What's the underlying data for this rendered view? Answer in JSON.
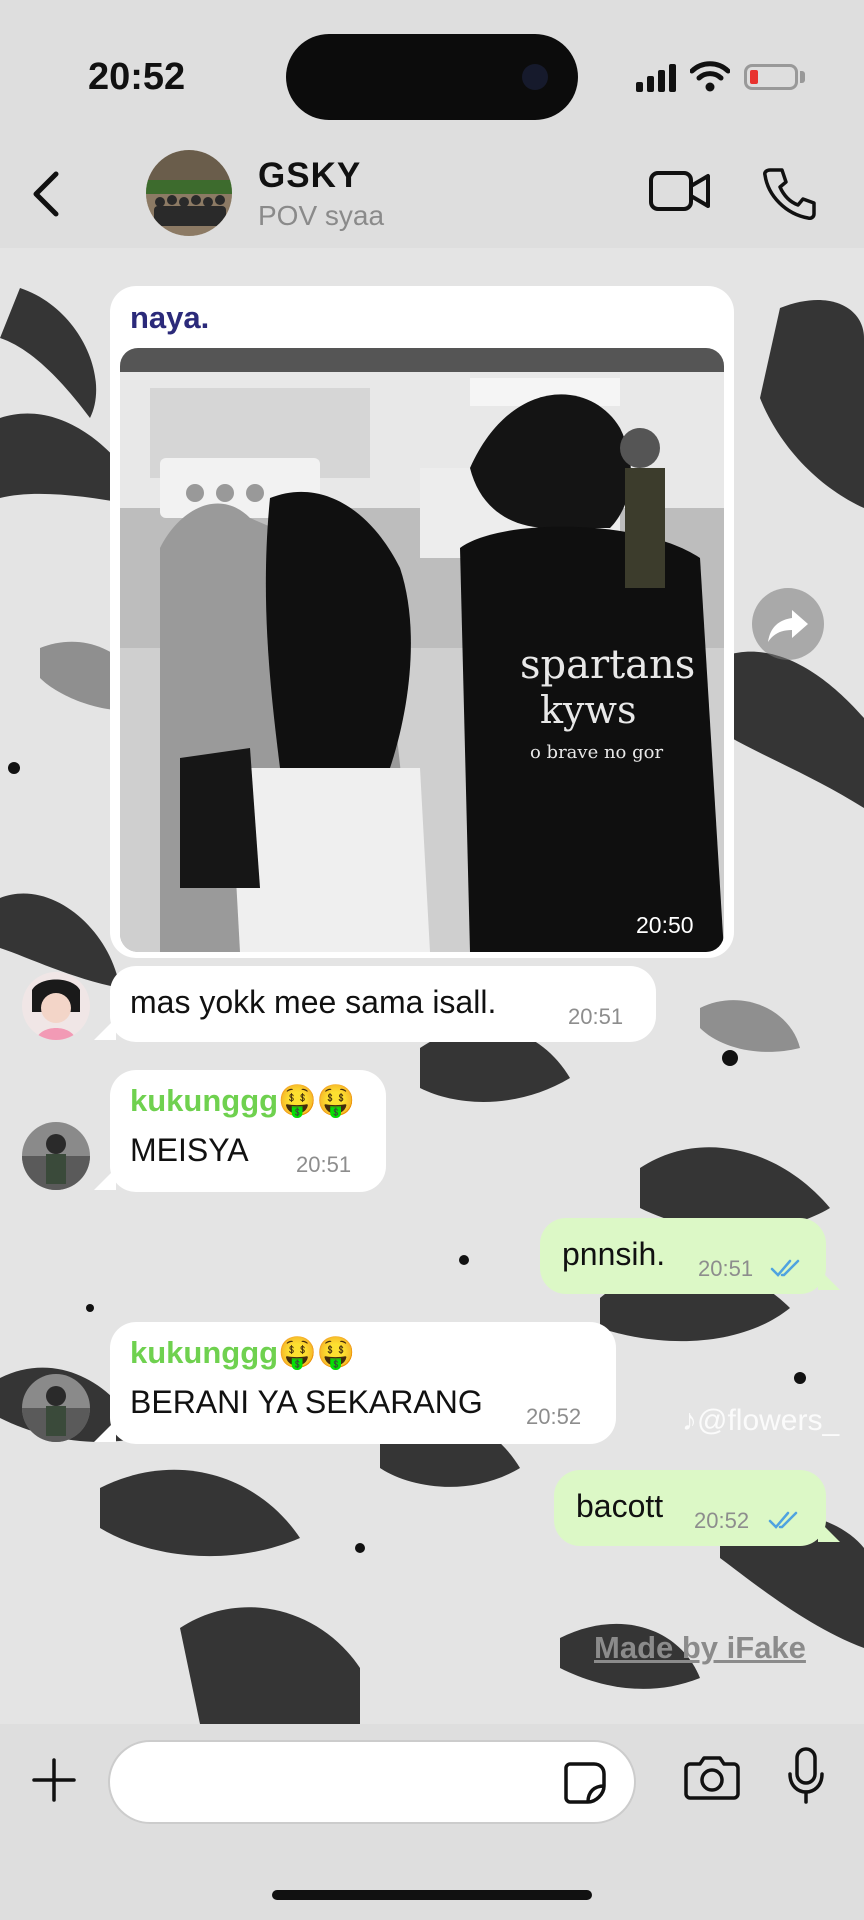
{
  "status_bar": {
    "time": "20:52"
  },
  "header": {
    "title": "GSKY",
    "subtitle": "POV syaa",
    "icons": [
      "back-chevron-icon",
      "video-camera-icon",
      "phone-icon"
    ]
  },
  "messages": [
    {
      "type": "image",
      "sender": "naya.",
      "sender_color": "#2b2a7a",
      "time": "20:50"
    },
    {
      "type": "text",
      "text": "mas yokk mee sama isall.",
      "time": "20:51",
      "direction": "incoming"
    },
    {
      "type": "text",
      "sender": "kukunggg🤑🤑",
      "sender_color": "#6fd14f",
      "text": "MEISYA",
      "time": "20:51",
      "direction": "incoming"
    },
    {
      "type": "text",
      "text": "pnnsih.",
      "time": "20:51",
      "direction": "outgoing",
      "read": true
    },
    {
      "type": "text",
      "sender": "kukunggg🤑🤑",
      "sender_color": "#6fd14f",
      "text": "BERANI YA SEKARANG",
      "time": "20:52",
      "direction": "incoming"
    },
    {
      "type": "text",
      "text": "bacott",
      "time": "20:52",
      "direction": "outgoing",
      "read": true
    }
  ],
  "overlay": {
    "tiktok_watermark": "♪@flowers_",
    "made_by": "Made by iFake"
  },
  "input_bar": {
    "placeholder": "",
    "icons": [
      "plus-icon",
      "sticker-icon",
      "camera-icon",
      "microphone-icon"
    ]
  },
  "colors": {
    "outgoing_bubble": "#dcf8c6",
    "incoming_bubble": "#ffffff",
    "read_ticks": "#4fa3e0"
  }
}
